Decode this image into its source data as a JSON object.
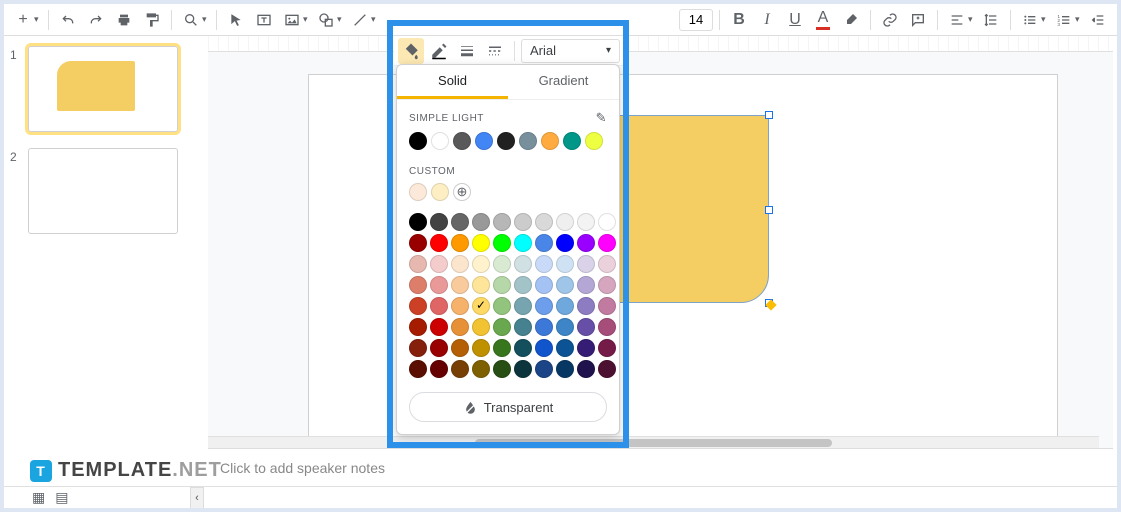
{
  "toolbar": {
    "font_size": "14"
  },
  "font_selector": {
    "value": "Arial"
  },
  "popup": {
    "tab_solid": "Solid",
    "tab_gradient": "Gradient",
    "section_theme": "SIMPLE LIGHT",
    "section_custom": "CUSTOM",
    "transparent_label": "Transparent",
    "theme_colors": [
      "#000000",
      "#ffffff",
      "#595959",
      "#4285f4",
      "#212121",
      "#78909c",
      "#ffab40",
      "#009688",
      "#eeff41"
    ],
    "custom_colors": [
      "#fde9d9",
      "#fdeec4"
    ],
    "grid_colors": [
      "#000000",
      "#434343",
      "#666666",
      "#999999",
      "#b7b7b7",
      "#cccccc",
      "#d9d9d9",
      "#efefef",
      "#f3f3f3",
      "#ffffff",
      "#980000",
      "#ff0000",
      "#ff9900",
      "#ffff00",
      "#00ff00",
      "#00ffff",
      "#4a86e8",
      "#0000ff",
      "#9900ff",
      "#ff00ff",
      "#e6b8af",
      "#f4cccc",
      "#fce5cd",
      "#fff2cc",
      "#d9ead3",
      "#d0e0e3",
      "#c9daf8",
      "#cfe2f3",
      "#d9d2e9",
      "#ead1dc",
      "#dd7e6b",
      "#ea9999",
      "#f9cb9c",
      "#ffe599",
      "#b6d7a8",
      "#a2c4c9",
      "#a4c2f4",
      "#9fc5e8",
      "#b4a7d6",
      "#d5a6bd",
      "#cc4125",
      "#e06666",
      "#f6b26b",
      "#ffd966",
      "#93c47d",
      "#76a5af",
      "#6d9eeb",
      "#6fa8dc",
      "#8e7cc3",
      "#c27ba0",
      "#a61c00",
      "#cc0000",
      "#e69138",
      "#f1c232",
      "#6aa84f",
      "#45818e",
      "#3c78d8",
      "#3d85c6",
      "#674ea7",
      "#a64d79",
      "#85200c",
      "#990000",
      "#b45f06",
      "#bf9000",
      "#38761d",
      "#134f5c",
      "#1155cc",
      "#0b5394",
      "#351c75",
      "#741b47",
      "#5b0f00",
      "#660000",
      "#783f04",
      "#7f6000",
      "#274e13",
      "#0c343d",
      "#1c4587",
      "#073763",
      "#20124d",
      "#4c1130"
    ],
    "selected_grid_index": 43
  },
  "sidebar": {
    "slides": [
      {
        "num": "1",
        "selected": true,
        "has_shape": true
      },
      {
        "num": "2",
        "selected": false,
        "has_shape": false
      }
    ]
  },
  "notes": {
    "placeholder": "Click to add speaker notes"
  },
  "watermark": {
    "brand": "TEMPLATE",
    "suffix": ".NET"
  }
}
